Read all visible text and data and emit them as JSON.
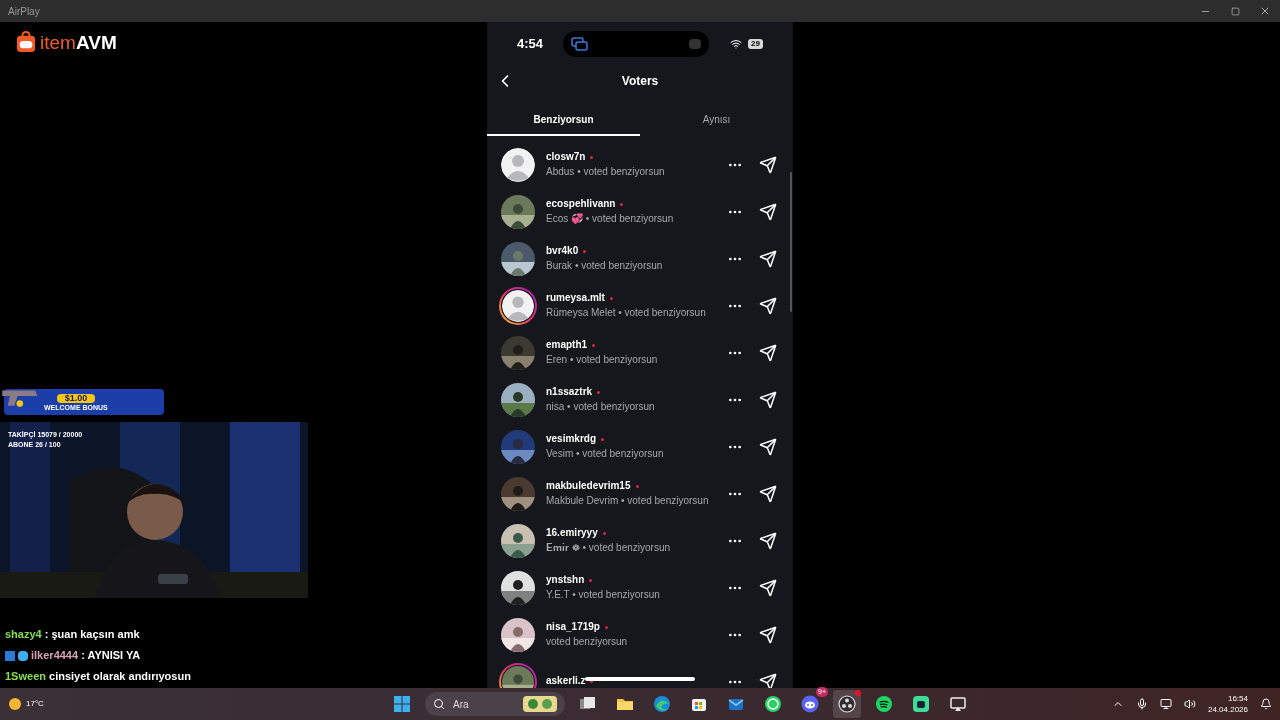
{
  "window": {
    "title": "AirPlay"
  },
  "stream": {
    "logo": {
      "prefix": "item",
      "suffix": "AVM"
    },
    "ad": {
      "amount": "$1.00",
      "caption": "WELCOME BONUS"
    },
    "goals": [
      "TAKİPÇİ 15079 / 20000",
      "ABONE 26 / 100"
    ],
    "webcam": {
      "kind": "picture"
    },
    "chat": [
      {
        "user": "shazy4",
        "text": ": şuan kaçsın amk",
        "color": "#86e04e",
        "badges": false
      },
      {
        "user": "ilker4444",
        "text": ": AYNISI YA",
        "color": "#d9a3b4",
        "badges": true
      },
      {
        "user": "1Sween",
        "text": "cinsiyet olarak andırıyosun",
        "color": "#86e04e",
        "badges": false
      }
    ]
  },
  "phone": {
    "time": "4:54",
    "battery": "29",
    "title": "Voters",
    "tabs": [
      {
        "label": "Benziyorsun",
        "selected": true
      },
      {
        "label": "Aynısı",
        "selected": false
      }
    ],
    "voters": [
      {
        "username": "closw7n",
        "subtitle": "Abdus • voted benziyorsun",
        "kind": "default",
        "story": false
      },
      {
        "username": "ecospehlivann",
        "subtitle": "Ecos 💞 • voted benziyorsun",
        "story": false
      },
      {
        "username": "bvr4k0",
        "subtitle": "Burak • voted benziyorsun",
        "story": false
      },
      {
        "username": "rumeysa.mlt",
        "subtitle": "Rümeysa Melet • voted benziyorsun",
        "kind": "default",
        "story": true
      },
      {
        "username": "emapth1",
        "subtitle": "Eren • voted benziyorsun",
        "story": false
      },
      {
        "username": "n1ssaztrk",
        "subtitle": "nisa • voted benziyorsun",
        "story": false
      },
      {
        "username": "vesimkrdg",
        "subtitle": "Vesim • voted benziyorsun",
        "story": false
      },
      {
        "username": "makbuledevrim15",
        "subtitle": "Makbule Devrim • voted benziyorsun",
        "story": false
      },
      {
        "username": "16.emiryyy",
        "subtitle": "𝐄𝐦𝐢𝐫 ❁ • voted benziyorsun",
        "story": false
      },
      {
        "username": "ynstshn",
        "subtitle": "Y.E.T • voted benziyorsun",
        "story": false
      },
      {
        "username": "nisa_1719p",
        "subtitle": "voted benziyorsun",
        "story": false
      },
      {
        "username": "askerli.z",
        "story": true
      }
    ]
  },
  "taskbar": {
    "weather": "17°C",
    "search": {
      "placeholder": "Ara"
    },
    "apps": [
      {
        "kind": "taskview",
        "selected": false
      },
      {
        "kind": "folder",
        "selected": false
      },
      {
        "kind": "edge",
        "selected": false
      },
      {
        "kind": "store",
        "selected": false
      },
      {
        "kind": "mail",
        "selected": false
      },
      {
        "kind": "whatsapp",
        "selected": false
      },
      {
        "kind": "discord",
        "selected": false,
        "badge": "9+"
      },
      {
        "kind": "obs",
        "selected": true
      },
      {
        "kind": "spotify",
        "selected": false
      },
      {
        "kind": "app",
        "selected": false
      },
      {
        "kind": "cast",
        "selected": false
      }
    ],
    "time": "16:54",
    "date": "24.04.2026"
  }
}
